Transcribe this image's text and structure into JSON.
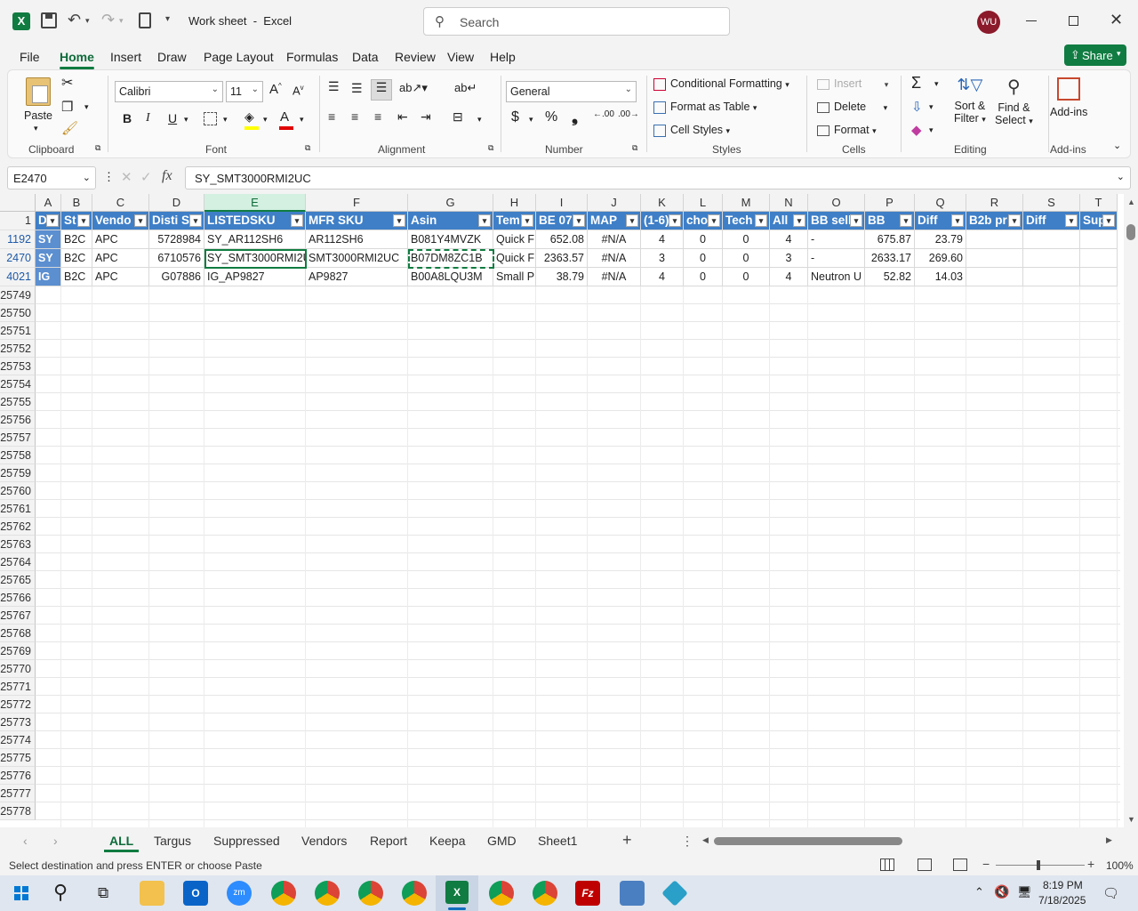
{
  "window": {
    "title": "Work sheet  -  Excel",
    "search_placeholder": "Search",
    "avatar": "WU"
  },
  "ribbon_tabs": [
    "File",
    "Home",
    "Insert",
    "Draw",
    "Page Layout",
    "Formulas",
    "Data",
    "Review",
    "View",
    "Help"
  ],
  "share_label": "Share",
  "clipboard": {
    "paste": "Paste",
    "group": "Clipboard"
  },
  "font": {
    "name": "Calibri",
    "size": "11",
    "group": "Font",
    "bold": "B",
    "italic": "I",
    "underline": "U"
  },
  "alignment": {
    "group": "Alignment"
  },
  "number": {
    "format": "General",
    "group": "Number"
  },
  "styles": {
    "cond": "Conditional Formatting",
    "table": "Format as Table",
    "cell": "Cell Styles",
    "group": "Styles"
  },
  "cells": {
    "insert": "Insert",
    "delete": "Delete",
    "format": "Format",
    "group": "Cells"
  },
  "editing": {
    "sort1": "Sort &",
    "sort2": "Filter",
    "find1": "Find &",
    "find2": "Select",
    "group": "Editing"
  },
  "addins": {
    "label": "Add-ins",
    "group": "Add-ins"
  },
  "formula_bar": {
    "name_box": "E2470",
    "formula": "SY_SMT3000RMI2UC",
    "fx": "fx"
  },
  "columns": [
    "A",
    "B",
    "C",
    "D",
    "E",
    "F",
    "G",
    "H",
    "I",
    "J",
    "K",
    "L",
    "M",
    "N",
    "O",
    "P",
    "Q",
    "R",
    "S",
    "T"
  ],
  "header_row": {
    "row_num": "1",
    "cells": [
      "D",
      "St",
      "Vendo",
      "Disti S",
      "LISTEDSKU",
      "MFR SKU",
      "Asin",
      "Tem",
      "BE 07",
      "MAP",
      "(1-6)",
      "cho",
      "Tech",
      "All",
      "BB sell",
      "BB",
      "Diff",
      "B2b pr",
      "Diff",
      "Sup"
    ]
  },
  "rows": [
    {
      "num": "1192",
      "cells": [
        "SY",
        "B2C",
        "APC",
        "5728984",
        "SY_AR112SH6",
        "AR112SH6",
        "B081Y4MVZK",
        "Quick F",
        "652.08",
        "#N/A",
        "4",
        "0",
        "0",
        "4",
        "-",
        "675.87",
        "23.79",
        "",
        "",
        ""
      ]
    },
    {
      "num": "2470",
      "cells": [
        "SY",
        "B2C",
        "APC",
        "6710576",
        "SY_SMT3000RMI2U",
        "SMT3000RMI2UC",
        "B07DM8ZC1B",
        "Quick F",
        "2363.57",
        "#N/A",
        "3",
        "0",
        "0",
        "3",
        "-",
        "2633.17",
        "269.60",
        "",
        "",
        ""
      ]
    },
    {
      "num": "4021",
      "cells": [
        "IG",
        "B2C",
        "APC",
        "G07886",
        "IG_AP9827",
        "AP9827",
        "B00A8LQU3M",
        "Small P",
        "38.79",
        "#N/A",
        "4",
        "0",
        "0",
        "4",
        "Neutron U",
        "52.82",
        "14.03",
        "",
        "",
        ""
      ]
    }
  ],
  "empty_rows": [
    "25749",
    "25750",
    "25751",
    "25752",
    "25753",
    "25754",
    "25755",
    "25756",
    "25757",
    "25758",
    "25759",
    "25760",
    "25761",
    "25762",
    "25763",
    "25764",
    "25765",
    "25766",
    "25767",
    "25768",
    "25769",
    "25770",
    "25771",
    "25772",
    "25773",
    "25774",
    "25775",
    "25776",
    "25777",
    "25778"
  ],
  "sheet_tabs": [
    "ALL",
    "Targus",
    "Suppressed",
    "Vendors",
    "Report",
    "Keepa",
    "GMD",
    "Sheet1"
  ],
  "status": {
    "message": "Select destination and press ENTER or choose Paste",
    "zoom": "100%"
  },
  "clock": {
    "time": "8:19 PM",
    "date": "7/18/2025"
  },
  "colors": {
    "excel_green": "#107c41",
    "header_fill": "#3f7fc7"
  }
}
